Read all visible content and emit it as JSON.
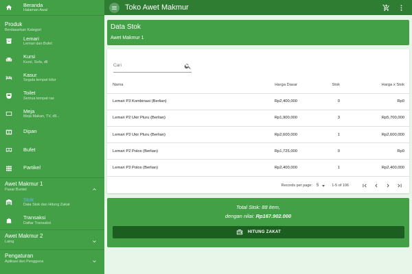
{
  "app": {
    "title": "Toko Awet Makmur"
  },
  "sidebar": {
    "beranda": {
      "title": "Beranda",
      "sub": "Halaman Awal"
    },
    "produk_section": {
      "title": "Produk",
      "sub": "Berdasarkan Kategori"
    },
    "items": [
      {
        "title": "Lemari",
        "sub": "Lemari dan Bufet"
      },
      {
        "title": "Kursi",
        "sub": "Kursi, Sofa, dll"
      },
      {
        "title": "Kasur",
        "sub": "Segala tempat tidur"
      },
      {
        "title": "Toilet",
        "sub": "Semua tempat ras"
      },
      {
        "title": "Meja",
        "sub": "Meja Makan, TV, dll..."
      },
      {
        "title": "Dipan",
        "sub": ""
      },
      {
        "title": "Bufet",
        "sub": ""
      },
      {
        "title": "Partikel",
        "sub": ""
      }
    ],
    "group1": {
      "title": "Awet Makmur 1",
      "sub": "Pasar Buntet"
    },
    "stok": {
      "title": "Stok",
      "sub": "Data Stok dan Hitung Zakat"
    },
    "transaksi": {
      "title": "Transaksi",
      "sub": "Daftar Transaksi"
    },
    "group2": {
      "title": "Awet Makmur 2",
      "sub": "Laing"
    },
    "pengaturan": {
      "title": "Pengaturan",
      "sub": "Aplikasi dan Pengguna"
    }
  },
  "header": {
    "title": "Data Stok",
    "subtitle": "Awet Makmur 1"
  },
  "search": {
    "placeholder": "Cari"
  },
  "table": {
    "columns": [
      "Nama",
      "Harga Dasar",
      "Stok",
      "Harga x Stok"
    ],
    "rows": [
      [
        "Lemari P3 Kombinasi (Berlian)",
        "Rp2,400,000",
        "0",
        "Rp0"
      ],
      [
        "Lemari P2 Ukir Pluru (Berlian)",
        "Rp1,900,000",
        "3",
        "Rp5,700,000"
      ],
      [
        "Lemari P3 Ukir Pluru (Berlian)",
        "Rp2,600,000",
        "1",
        "Rp2,600,000"
      ],
      [
        "Lemari P2 Polos (Berlian)",
        "Rp1,725,000",
        "0",
        "Rp0"
      ],
      [
        "Lemari P3 Polos (Berlian)",
        "Rp2,400,000",
        "1",
        "Rp2,400,000"
      ]
    ]
  },
  "pager": {
    "rows_per_page_label": "Records per page:",
    "rows_per_page": "5",
    "range": "1-5 of 106"
  },
  "total": {
    "line1": "Total Stok: 88 item,",
    "line2_prefix": "dengan nilai: ",
    "line2_value": "Rp167.902.000",
    "button": "HITUNG ZAKAT"
  },
  "colors": {
    "primary": "#43a047",
    "appbar": "#2e7d32",
    "button": "#1b5e20",
    "background": "#e8f5e9",
    "active_text": "#64b5f6"
  }
}
